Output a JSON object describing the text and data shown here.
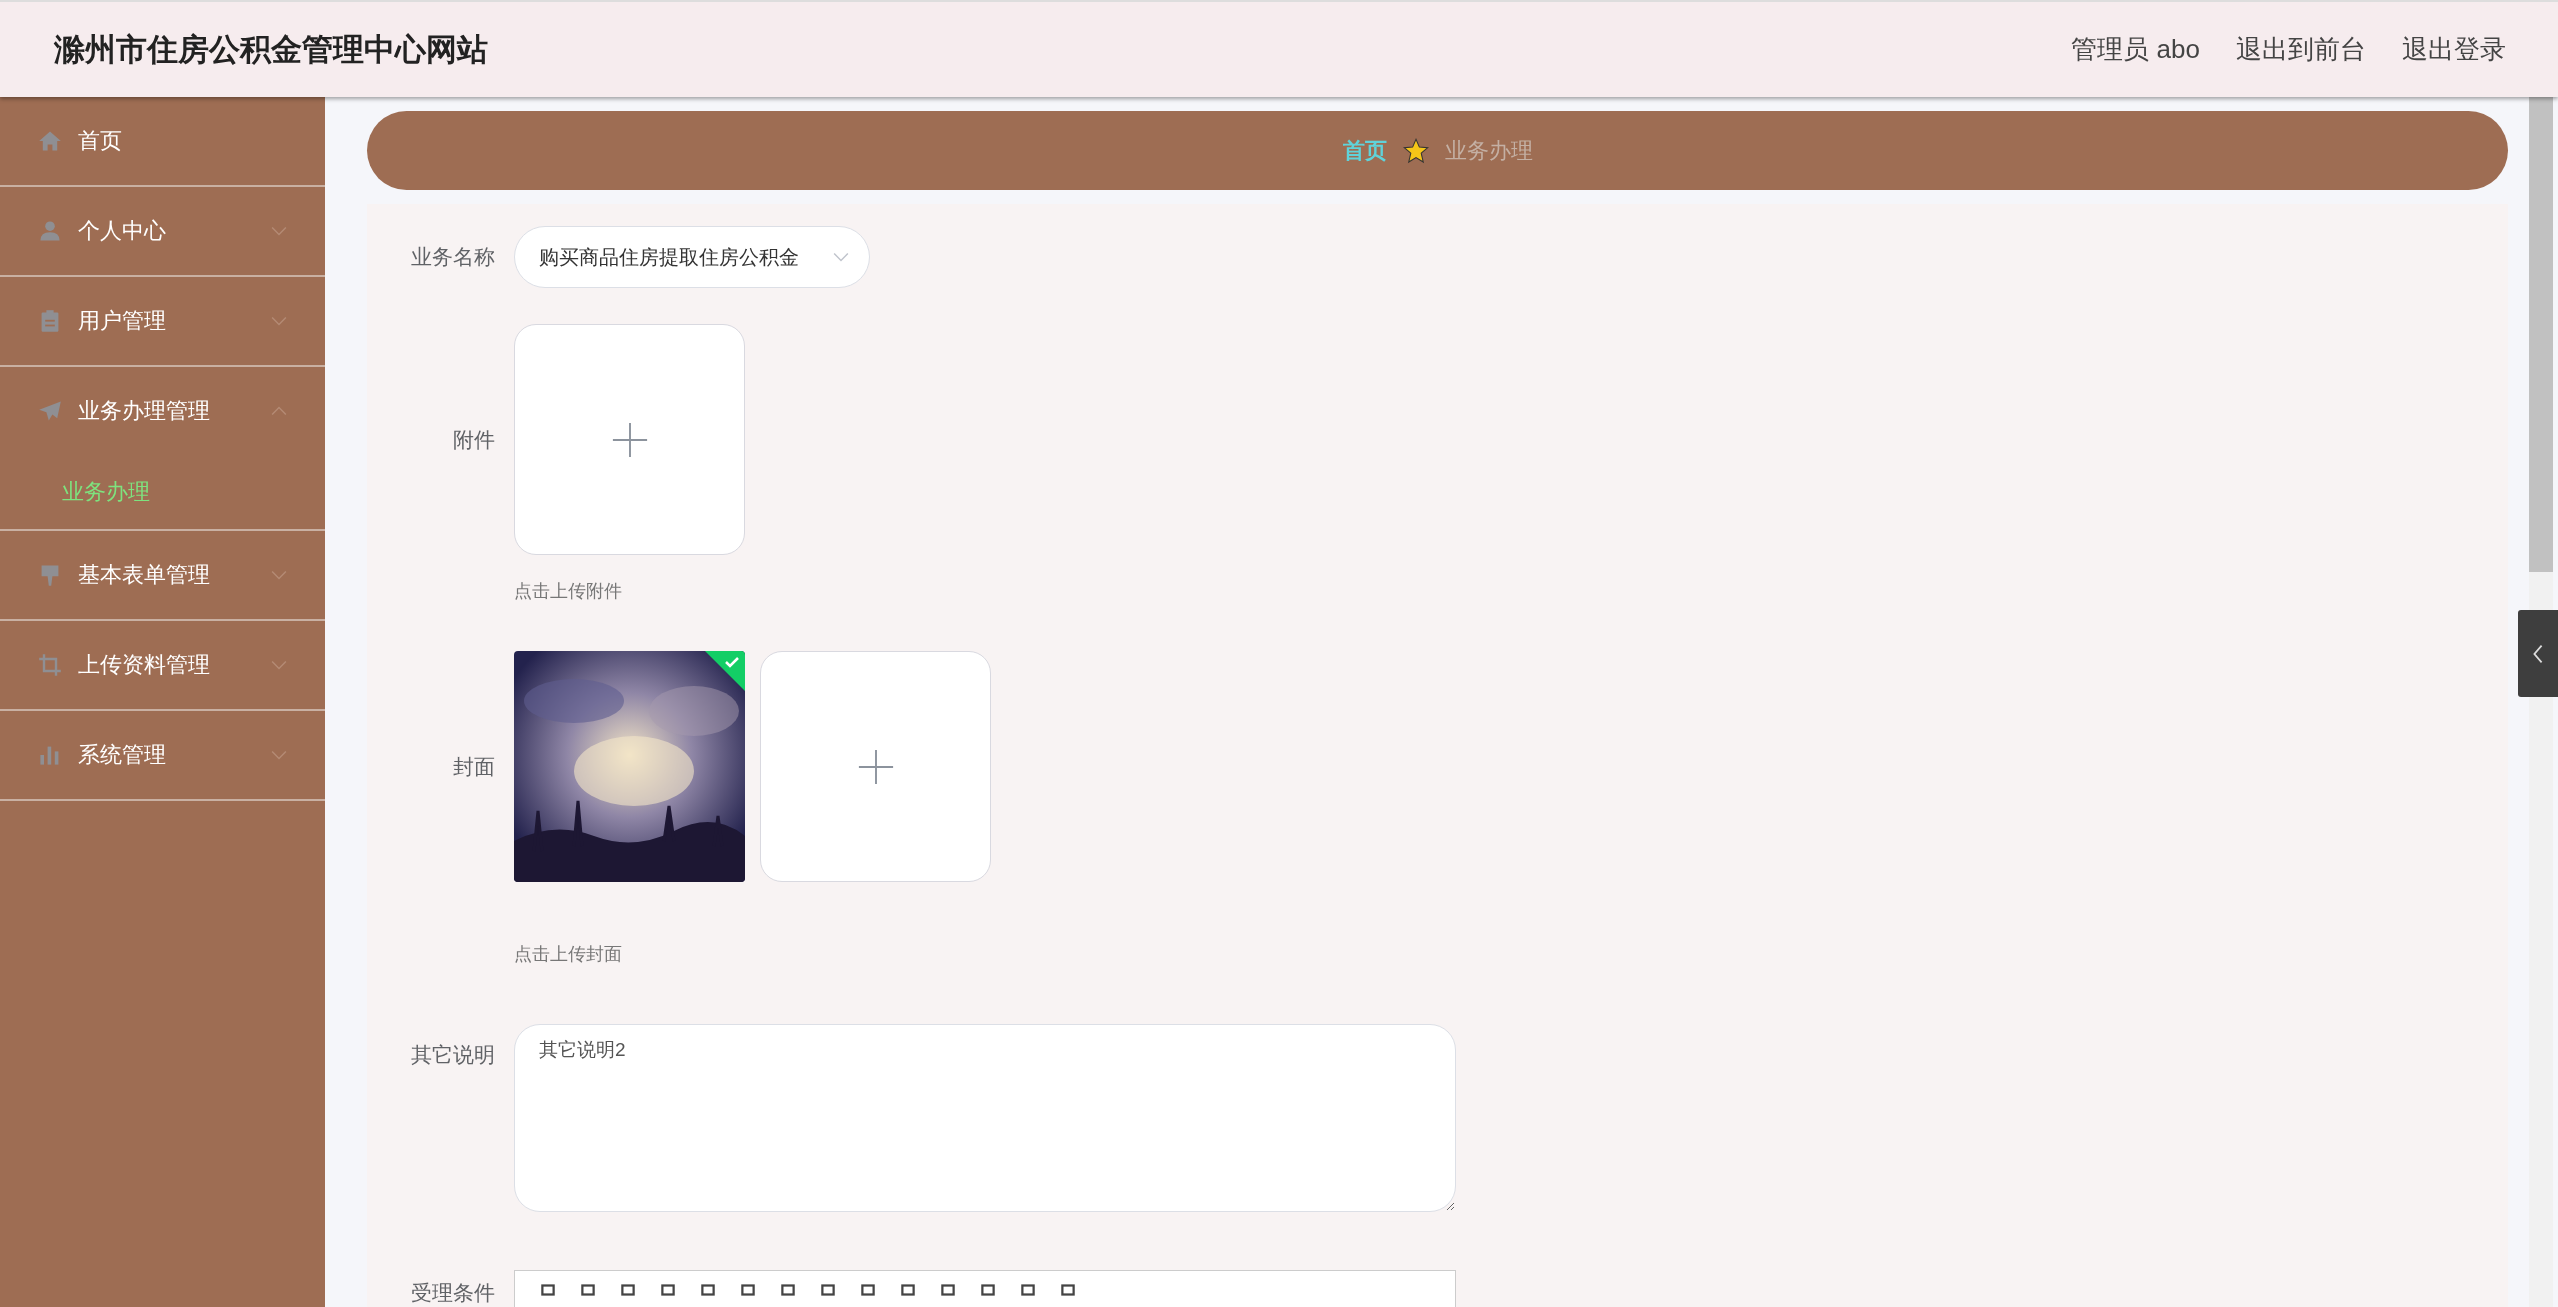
{
  "header": {
    "title": "滁州市住房公积金管理中心网站",
    "user": "管理员 abo",
    "links": [
      "退出到前台",
      "退出登录"
    ]
  },
  "sidebar": {
    "items": [
      {
        "label": "首页",
        "kind": "link"
      },
      {
        "label": "个人中心",
        "kind": "menu",
        "expanded": false
      },
      {
        "label": "用户管理",
        "kind": "menu",
        "expanded": false
      },
      {
        "label": "业务办理管理",
        "kind": "menu",
        "expanded": true,
        "children": [
          {
            "label": "业务办理",
            "selected": true
          }
        ]
      },
      {
        "label": "基本表单管理",
        "kind": "menu",
        "expanded": false
      },
      {
        "label": "上传资料管理",
        "kind": "menu",
        "expanded": false
      },
      {
        "label": "系统管理",
        "kind": "menu",
        "expanded": false
      }
    ]
  },
  "breadcrumb": [
    "首页",
    "业务办理"
  ],
  "form": {
    "fields": [
      {
        "kind": "select",
        "label": "业务名称",
        "value": "购买商品住房提取住房公积金"
      },
      {
        "kind": "upload",
        "label": "附件",
        "hint": "点击上传附件"
      },
      {
        "kind": "upload",
        "label": "封面",
        "hint": "点击上传封面",
        "images": [
          {
            "kind": "picture",
            "success": true
          }
        ]
      },
      {
        "kind": "textarea",
        "label": "其它说明",
        "value": "其它说明2"
      },
      {
        "kind": "editor",
        "label": "受理条件"
      }
    ]
  }
}
